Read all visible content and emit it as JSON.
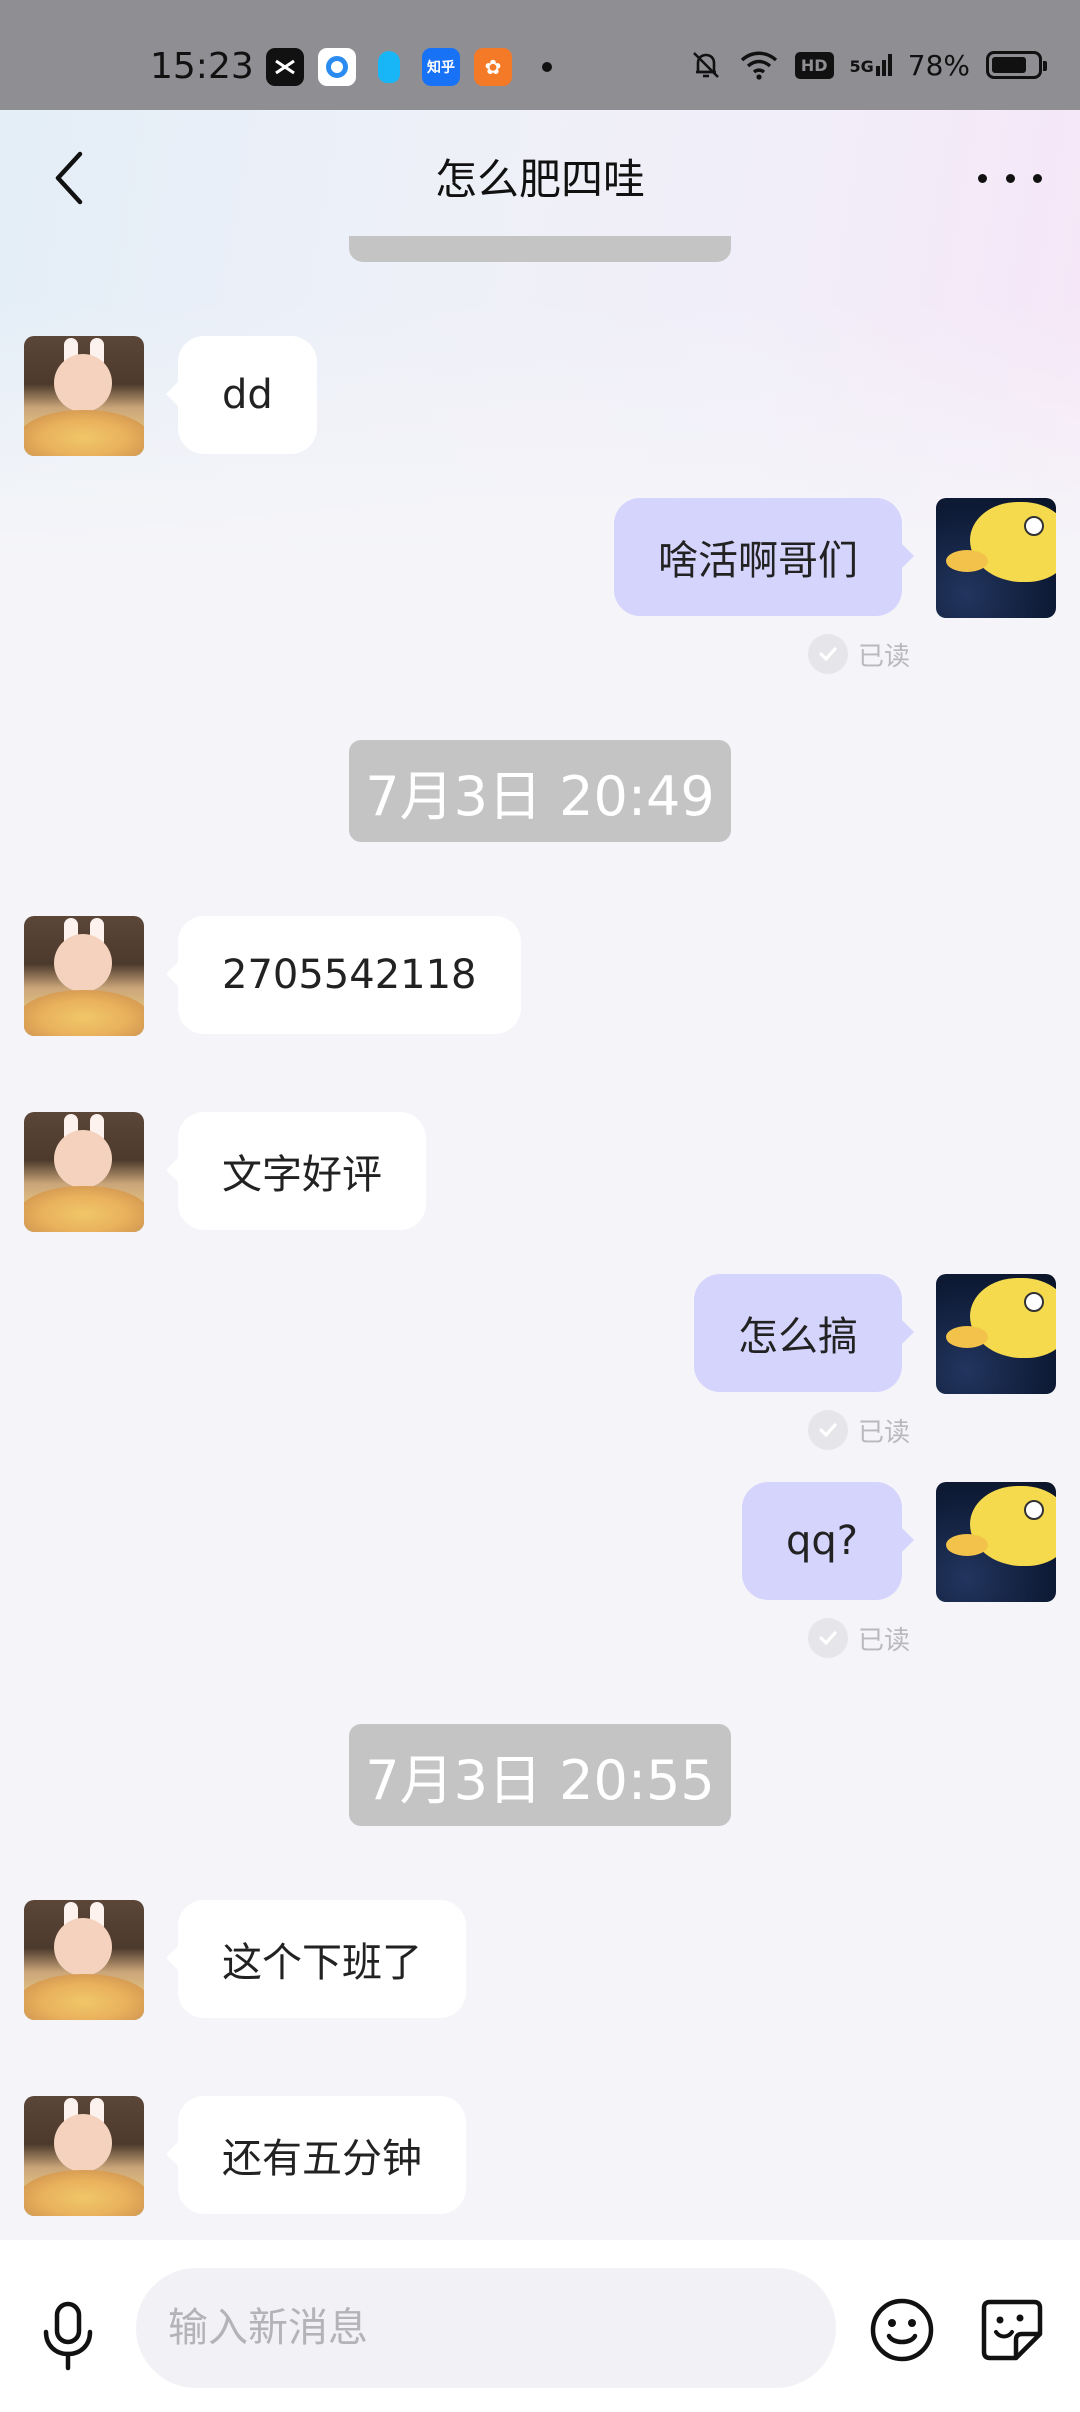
{
  "status_bar": {
    "time": "15:23",
    "battery": "78%",
    "battery_level": 0.78,
    "network": "5G",
    "hd": "HD",
    "app_icons": [
      "capcut-icon",
      "blue-circle-app-icon",
      "qq-icon",
      "zhihu-icon",
      "uc-browser-icon"
    ],
    "zhihu_label": "知乎"
  },
  "header": {
    "title": "怎么肥四哇"
  },
  "messages": [
    {
      "side": "left",
      "text": "dd"
    },
    {
      "side": "right",
      "text": "啥活啊哥们",
      "read": "已读"
    },
    {
      "type": "timestamp",
      "text": "7月3日 20:49"
    },
    {
      "side": "left",
      "text": "2705542118"
    },
    {
      "side": "left",
      "text": "文字好评"
    },
    {
      "side": "right",
      "text": "怎么搞",
      "read": "已读"
    },
    {
      "side": "right",
      "text": "qq?",
      "read": "已读"
    },
    {
      "type": "timestamp",
      "text": "7月3日 20:55"
    },
    {
      "side": "left",
      "text": "这个下班了"
    },
    {
      "side": "left",
      "text": "还有五分钟"
    }
  ],
  "input": {
    "placeholder": "输入新消息"
  },
  "colors": {
    "status_bar_bg": "#8f8e93",
    "page_bg": "#f5f5f9",
    "sent_bubble": "#d5d4fd",
    "received_bubble": "#ffffff",
    "timestamp_pill": "#c4c4c4",
    "read_text": "#b8b8bd"
  }
}
